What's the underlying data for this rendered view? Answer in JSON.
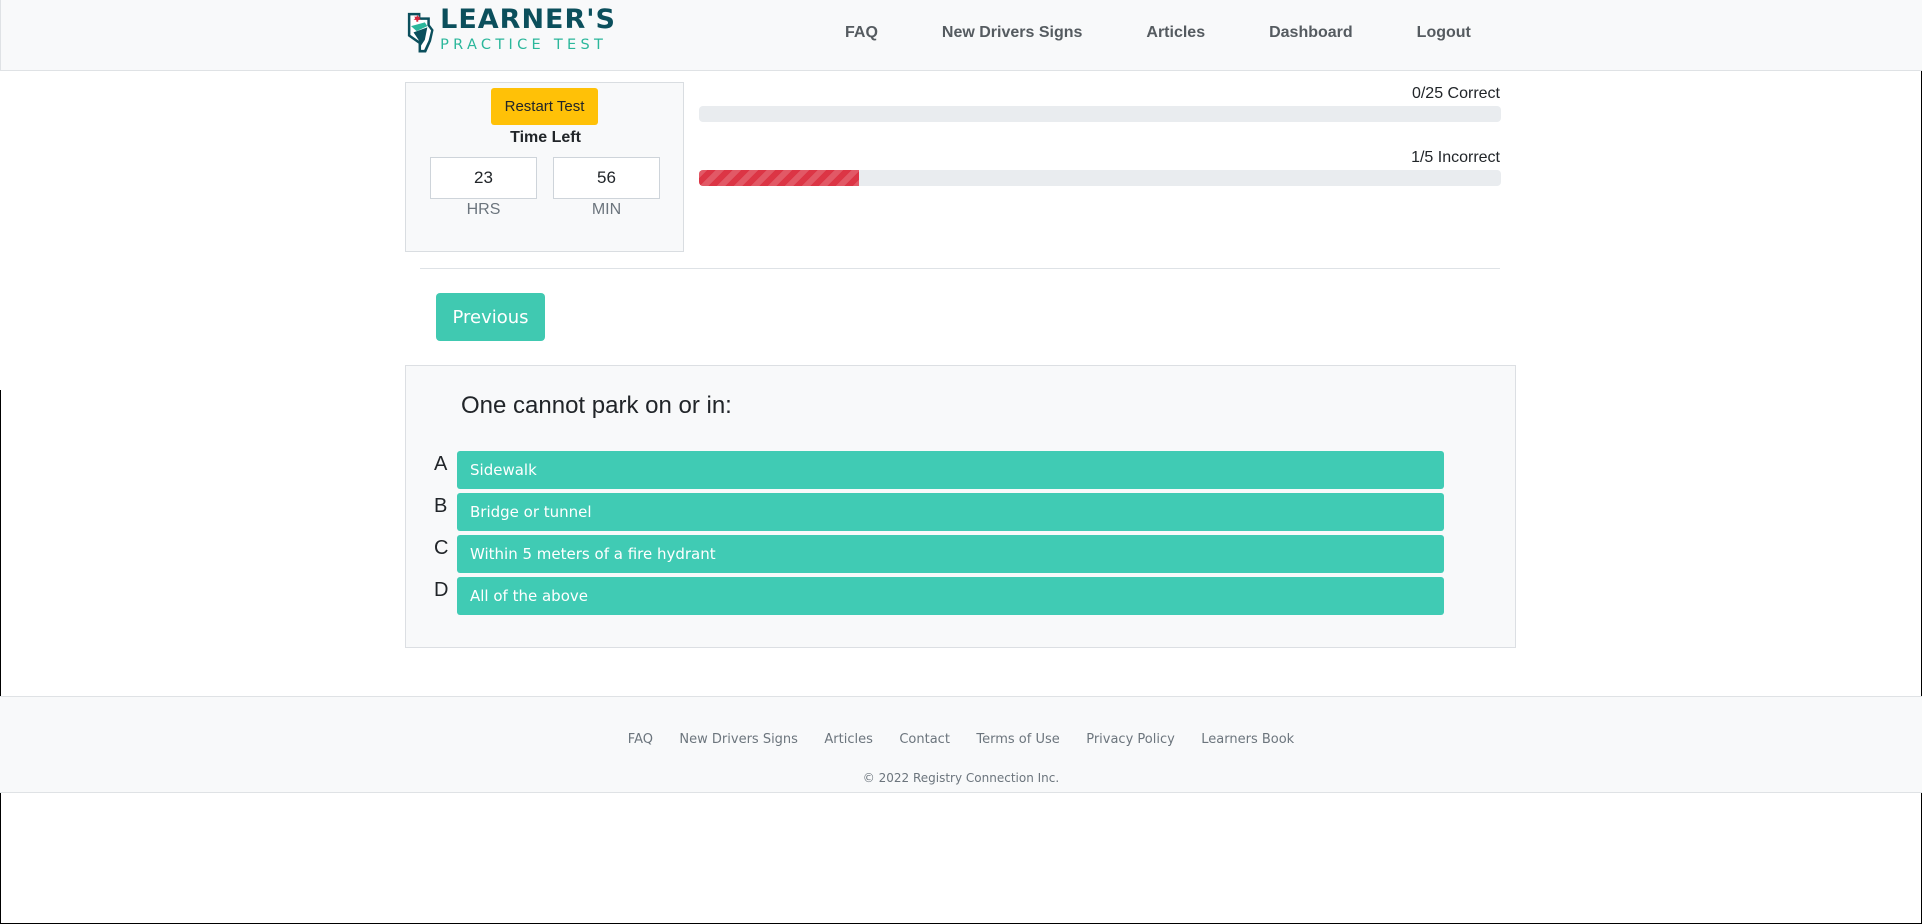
{
  "header": {
    "logo_title": "LEARNER'S",
    "logo_subtitle": "PRACTICE TEST",
    "nav": [
      "FAQ",
      "New Drivers Signs",
      "Articles",
      "Dashboard",
      "Logout"
    ]
  },
  "timer": {
    "restart_label": "Restart Test",
    "time_left_label": "Time Left",
    "hours": "23",
    "minutes": "56",
    "hours_unit": "HRS",
    "minutes_unit": "MIN"
  },
  "progress": {
    "correct_label": "0/25 Correct",
    "correct_fraction": 0,
    "incorrect_label": "1/5 Incorrect",
    "incorrect_fraction": 0.2
  },
  "navigation": {
    "previous_label": "Previous"
  },
  "question": {
    "text": "One cannot park on or in:",
    "answers": [
      {
        "letter": "A",
        "text": "Sidewalk"
      },
      {
        "letter": "B",
        "text": "Bridge or tunnel"
      },
      {
        "letter": "C",
        "text": "Within 5 meters of a fire hydrant"
      },
      {
        "letter": "D",
        "text": "All of the above"
      }
    ]
  },
  "footer": {
    "links": [
      "FAQ",
      "New Drivers Signs",
      "Articles",
      "Contact",
      "Terms of Use",
      "Privacy Policy",
      "Learners Book"
    ],
    "copyright": "© 2022 Registry Connection Inc."
  },
  "colors": {
    "accent_teal": "#40c9b1",
    "restart_yellow": "#ffc107",
    "incorrect_red": "#dc3545",
    "logo_navy": "#0b4f5c",
    "logo_teal": "#2bb79b"
  },
  "icons": {
    "logo": "province-shield-maple-leaf-logo"
  }
}
